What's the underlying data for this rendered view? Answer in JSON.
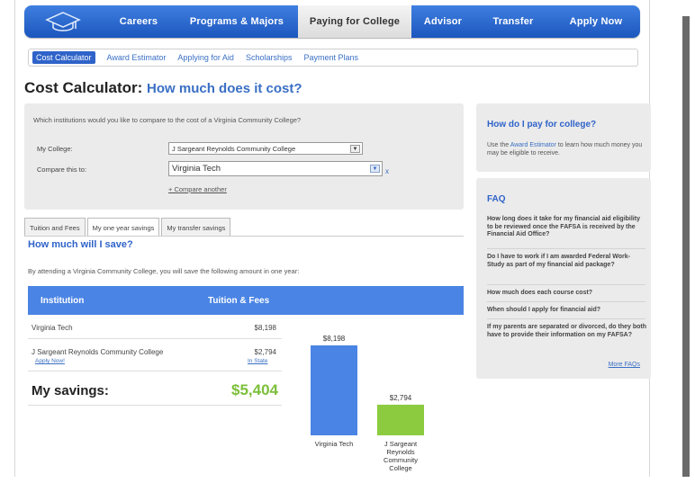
{
  "nav": {
    "items": [
      "Careers",
      "Programs & Majors",
      "Paying for College",
      "Advisor",
      "Transfer",
      "Apply Now"
    ],
    "active": 2
  },
  "subnav": {
    "items": [
      "Cost Calculator",
      "Award Estimator",
      "Applying for Aid",
      "Scholarships",
      "Payment Plans"
    ],
    "active": 0
  },
  "page": {
    "title": "Cost Calculator:",
    "subtitle": "How much does it cost?"
  },
  "compare": {
    "question": "Which institutions would you like to compare to the cost of a Virginia Community College?",
    "my_college_label": "My College:",
    "my_college_value": "J Sargeant Reynolds Community College",
    "compare_label": "Compare this to:",
    "compare_value": "Virginia Tech",
    "remove_link": "x",
    "compare_another": "+ Compare another"
  },
  "tabs": {
    "items": [
      "Tuition and Fees",
      "My one year savings",
      "My transfer savings"
    ],
    "active": 1
  },
  "savings": {
    "heading": "How much will I save?",
    "intro": "By attending a Virginia Community College, you will save the following amount in one year:",
    "col_institution": "Institution",
    "col_tuition": "Tuition & Fees",
    "row1_name": "Virginia Tech",
    "row1_value": "$8,198",
    "row2_name": "J Sargeant Reynolds Community College",
    "row2_value": "$2,794",
    "row2_apply": "Apply Now!",
    "row2_status": "In State",
    "savings_label": "My savings:",
    "savings_value": "$5,404"
  },
  "chart_data": {
    "type": "bar",
    "categories": [
      "Virginia Tech",
      "J Sargeant Reynolds Community College"
    ],
    "values": [
      8198,
      2794
    ],
    "value_labels": [
      "$8,198",
      "$2,794"
    ],
    "colors": [
      "#4a84e4",
      "#8ccb3f"
    ],
    "title": "",
    "xlabel": "",
    "ylabel": ""
  },
  "sidebar": {
    "pay_heading": "How do I pay for college?",
    "pay_text_before": "Use the ",
    "pay_link": "Award Estimator",
    "pay_text_after": " to learn how much money you may be eligible to receive.",
    "faq_heading": "FAQ",
    "faq_items": [
      "How long does it take for my financial aid eligibility to be reviewed once the FAFSA is received by the Financial Aid Office?",
      "Do I have to work if I am awarded Federal Work-Study as part of my financial aid package?",
      "How much does each course cost?",
      "When should I apply for financial aid?",
      "If my parents are separated or divorced, do they both have to provide their information on my FAFSA?"
    ],
    "more_faqs": "More FAQs"
  },
  "colors": {
    "nav_blue": "#2a66d0",
    "accent_blue": "#2f63c9",
    "savings_green": "#7cbf3a"
  }
}
